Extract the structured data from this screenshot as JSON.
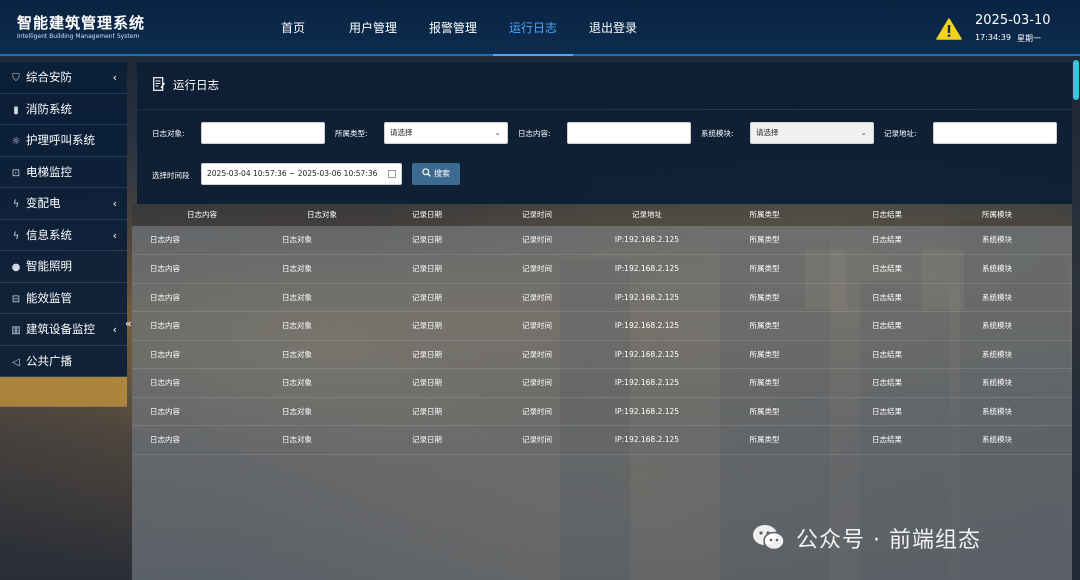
{
  "brand": {
    "title": "智能建筑管理系统",
    "subtitle": "Intelligent Building Management System"
  },
  "nav": [
    {
      "label": "首页",
      "active": false
    },
    {
      "label": "用户管理",
      "active": false
    },
    {
      "label": "报警管理",
      "active": false
    },
    {
      "label": "运行日志",
      "active": true
    },
    {
      "label": "退出登录",
      "active": false
    }
  ],
  "clock": {
    "date": "2025-03-10",
    "time": "17:34:39",
    "weekday": "星期一"
  },
  "sidebar": {
    "items": [
      {
        "label": "综合安防",
        "icon": "shield-icon",
        "glyph": "⛉",
        "chevron": "‹"
      },
      {
        "label": "消防系统",
        "icon": "fire-extinguisher-icon",
        "glyph": "▮",
        "chevron": ""
      },
      {
        "label": "护理呼叫系统",
        "icon": "nurse-call-icon",
        "glyph": "☼",
        "chevron": ""
      },
      {
        "label": "电梯监控",
        "icon": "elevator-icon",
        "glyph": "⊡",
        "chevron": ""
      },
      {
        "label": "变配电",
        "icon": "lightning-icon",
        "glyph": "ϟ",
        "chevron": "‹"
      },
      {
        "label": "信息系统",
        "icon": "lightning-icon",
        "glyph": "ϟ",
        "chevron": "‹"
      },
      {
        "label": "智能照明",
        "icon": "bulb-icon",
        "glyph": "●",
        "chevron": ""
      },
      {
        "label": "能效监管",
        "icon": "cabinet-icon",
        "glyph": "⊟",
        "chevron": ""
      },
      {
        "label": "建筑设备监控",
        "icon": "building-icon",
        "glyph": "▥",
        "chevron": "‹"
      },
      {
        "label": "公共广播",
        "icon": "speaker-icon",
        "glyph": "◁",
        "chevron": ""
      }
    ],
    "collapse_glyph": "«"
  },
  "panel": {
    "title": "运行日志"
  },
  "filters": {
    "log_object_label": "日志对象:",
    "category_label": "所属类型:",
    "category_value": "请选择",
    "log_content_label": "日志内容:",
    "module_label": "系统模块:",
    "module_value": "请选择",
    "address_label": "记录地址:",
    "time_range_label": "选择时间段",
    "time_range_value": "2025-03-04 10:57:36 ~ 2025-03-06 10:57:36",
    "search_label": "搜索"
  },
  "table": {
    "columns": [
      "日志内容",
      "日志对象",
      "记录日期",
      "记录时间",
      "记录地址",
      "所属类型",
      "日志结果",
      "所属模块"
    ],
    "rows": [
      [
        "日志内容",
        "日志对象",
        "记录日期",
        "记录时间",
        "IP:192.168.2.125",
        "所属类型",
        "日志结果",
        "系统模块"
      ],
      [
        "日志内容",
        "日志对象",
        "记录日期",
        "记录时间",
        "IP:192.168.2.125",
        "所属类型",
        "日志结果",
        "系统模块"
      ],
      [
        "日志内容",
        "日志对象",
        "记录日期",
        "记录时间",
        "IP:192.168.2.125",
        "所属类型",
        "日志结果",
        "系统模块"
      ],
      [
        "日志内容",
        "日志对象",
        "记录日期",
        "记录时间",
        "IP:192.168.2.125",
        "所属类型",
        "日志结果",
        "系统模块"
      ],
      [
        "日志内容",
        "日志对象",
        "记录日期",
        "记录时间",
        "IP:192.168.2.125",
        "所属类型",
        "日志结果",
        "系统模块"
      ],
      [
        "日志内容",
        "日志对象",
        "记录日期",
        "记录时间",
        "IP:192.168.2.125",
        "所属类型",
        "日志结果",
        "系统模块"
      ],
      [
        "日志内容",
        "日志对象",
        "记录日期",
        "记录时间",
        "IP:192.168.2.125",
        "所属类型",
        "日志结果",
        "系统模块"
      ],
      [
        "日志内容",
        "日志对象",
        "记录日期",
        "记录时间",
        "IP:192.168.2.125",
        "所属类型",
        "日志结果",
        "系统模块"
      ]
    ]
  },
  "watermark": {
    "text": "公众号 · 前端组态"
  },
  "colors": {
    "header_bg": "#0c2b4e",
    "accent": "#4ea6ff",
    "highlight": "#c8963c",
    "search_button": "#3d6a91",
    "warning": "#f5d21a"
  }
}
